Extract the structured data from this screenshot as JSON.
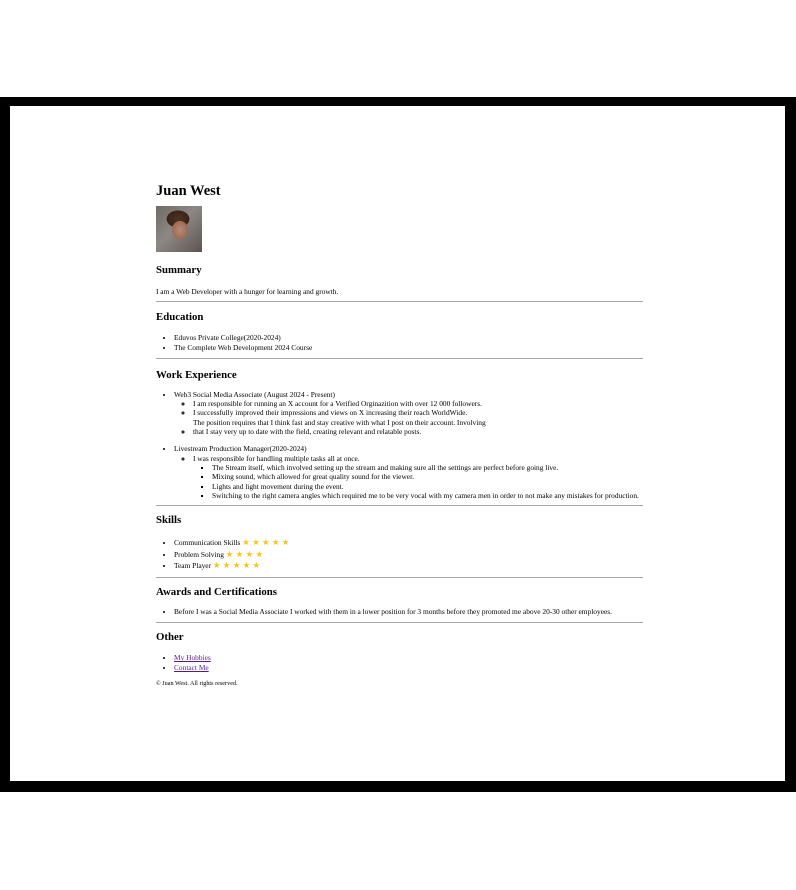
{
  "name": "Juan West",
  "photo_alt": "Juan West",
  "summary": {
    "heading": "Summary",
    "text": "I am a Web Developer with a hunger for learning and growth."
  },
  "education": {
    "heading": "Education",
    "items": [
      "Eduvos Private College(2020-2024)",
      "The Complete Web Development 2024 Course"
    ]
  },
  "work": {
    "heading": "Work Experience",
    "jobs": [
      {
        "title": "Web3 Social Media Associate (August 2024 - Present)",
        "duties": [
          "I am responsible for running an X account for a Verified Orginazition with over 12 000 followers.",
          "I successfully improved their impressions and views on X increasing their reach WorldWide.",
          "The position requires that I think fast and stay creative with what I post on their account. Involving that I stay very up to date with the field, creating relevant and relatable posts."
        ]
      },
      {
        "title": "Livestream Production Manager(2020-2024)",
        "duty": "I was responsible for handling multiple tasks all at once.",
        "tasks": [
          "The Stream itself, which involved setting up the stream and making sure all the settings are perfect before going live.",
          "Mixing sound, which allowed for great quality sound for the viewer.",
          "Lights and light movement during the event.",
          "Switching to the right camera angles which required me to be very vocal with my camera men in order to not make any mistakes for production."
        ]
      }
    ]
  },
  "skills": {
    "heading": "Skills",
    "items": [
      {
        "label": "Communication Skills",
        "stars": "★★★★★",
        "rating": 5
      },
      {
        "label": "Problem Solving",
        "stars": "★★★★",
        "rating": 4
      },
      {
        "label": "Team Player",
        "stars": "★★★★★",
        "rating": 5
      }
    ],
    "star_color": "#f5c518"
  },
  "awards": {
    "heading": "Awards and Certifications",
    "items": [
      "Before I was a Social Media Associate I worked with them in a lower position for 3 months before they promoted me above 20-30 other employees."
    ]
  },
  "other": {
    "heading": "Other",
    "links": [
      "My Hobbies",
      "Contact Me"
    ],
    "link_color": "#551a8b"
  },
  "footer": "© Juan West. All rights reserved."
}
